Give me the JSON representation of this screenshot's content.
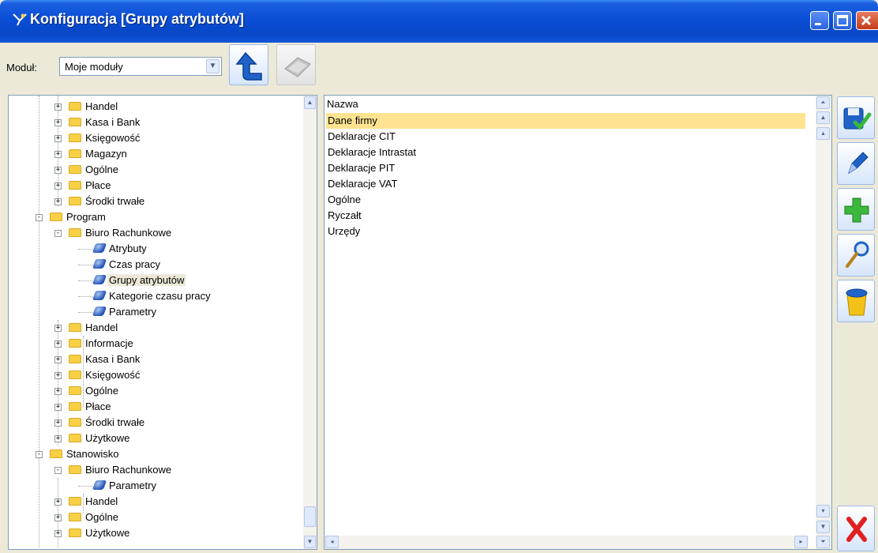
{
  "window": {
    "title": "Konfiguracja [Grupy atrybutów]"
  },
  "toolbar": {
    "modul_label": "Moduł:",
    "modul_value": "Moje moduły"
  },
  "tree": {
    "rows": [
      {
        "label": "Handel",
        "type": "folder",
        "level": 2,
        "exp": "+"
      },
      {
        "label": "Kasa i Bank",
        "type": "folder",
        "level": 2,
        "exp": "+"
      },
      {
        "label": "Księgowość",
        "type": "folder",
        "level": 2,
        "exp": "+"
      },
      {
        "label": "Magazyn",
        "type": "folder",
        "level": 2,
        "exp": "+"
      },
      {
        "label": "Ogólne",
        "type": "folder",
        "level": 2,
        "exp": "+"
      },
      {
        "label": "Płace",
        "type": "folder",
        "level": 2,
        "exp": "+"
      },
      {
        "label": "Środki trwałe",
        "type": "folder",
        "level": 2,
        "exp": "+"
      },
      {
        "label": "Program",
        "type": "folder",
        "level": 1,
        "exp": "-"
      },
      {
        "label": "Biuro Rachunkowe",
        "type": "folder",
        "level": 2,
        "exp": "-"
      },
      {
        "label": "Atrybuty",
        "type": "leaf",
        "level": 3
      },
      {
        "label": "Czas pracy",
        "type": "leaf",
        "level": 3
      },
      {
        "label": "Grupy atrybutów",
        "type": "leaf",
        "level": 3,
        "selected": true
      },
      {
        "label": "Kategorie czasu pracy",
        "type": "leaf",
        "level": 3
      },
      {
        "label": "Parametry",
        "type": "leaf",
        "level": 3
      },
      {
        "label": "Handel",
        "type": "folder",
        "level": 2,
        "exp": "+"
      },
      {
        "label": "Informacje",
        "type": "folder",
        "level": 2,
        "exp": "+"
      },
      {
        "label": "Kasa i Bank",
        "type": "folder",
        "level": 2,
        "exp": "+"
      },
      {
        "label": "Księgowość",
        "type": "folder",
        "level": 2,
        "exp": "+"
      },
      {
        "label": "Ogólne",
        "type": "folder",
        "level": 2,
        "exp": "+"
      },
      {
        "label": "Płace",
        "type": "folder",
        "level": 2,
        "exp": "+"
      },
      {
        "label": "Środki trwałe",
        "type": "folder",
        "level": 2,
        "exp": "+"
      },
      {
        "label": "Użytkowe",
        "type": "folder",
        "level": 2,
        "exp": "+"
      },
      {
        "label": "Stanowisko",
        "type": "folder",
        "level": 1,
        "exp": "-"
      },
      {
        "label": "Biuro Rachunkowe",
        "type": "folder",
        "level": 2,
        "exp": "-"
      },
      {
        "label": "Parametry",
        "type": "leaf",
        "level": 3
      },
      {
        "label": "Handel",
        "type": "folder",
        "level": 2,
        "exp": "+"
      },
      {
        "label": "Ogólne",
        "type": "folder",
        "level": 2,
        "exp": "+"
      },
      {
        "label": "Użytkowe",
        "type": "folder",
        "level": 2,
        "exp": "+"
      }
    ]
  },
  "list": {
    "header": "Nazwa",
    "rows": [
      "Dane firmy",
      "Deklaracje CIT",
      "Deklaracje Intrastat",
      "Deklaracje PIT",
      "Deklaracje VAT",
      "Ogólne",
      "Ryczałt",
      "Urzędy"
    ],
    "selected_index": 0
  },
  "colors": {
    "selection": "#ffe391",
    "titlebar": "#0a4ed6",
    "save_check": "#3cb83c",
    "add_plus": "#3cb83c",
    "close_x": "#e02020"
  }
}
